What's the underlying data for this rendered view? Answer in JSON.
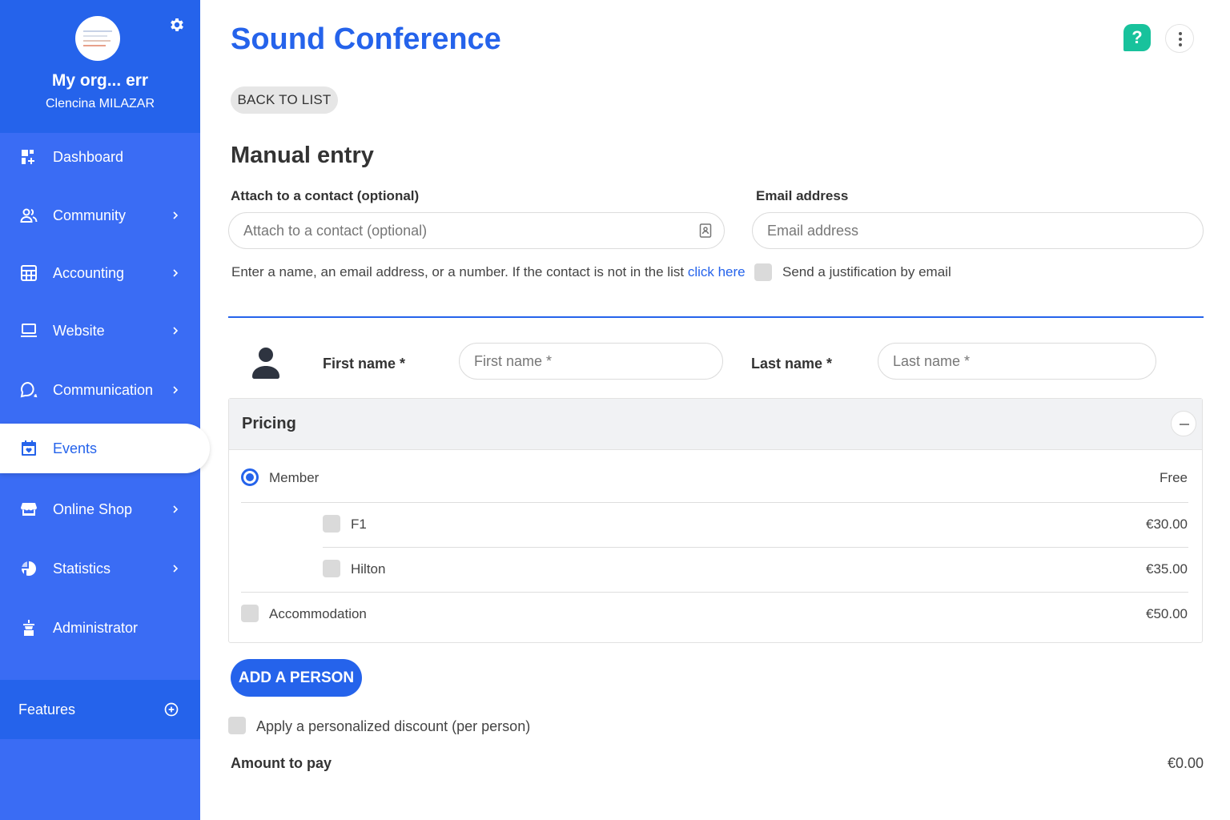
{
  "sidebar": {
    "org_name": "My org... err",
    "user_name": "Clencina MILAZAR",
    "items": [
      {
        "label": "Dashboard",
        "icon": "dashboard-icon"
      },
      {
        "label": "Community",
        "icon": "community-icon"
      },
      {
        "label": "Accounting",
        "icon": "calculator-icon"
      },
      {
        "label": "Website",
        "icon": "laptop-icon"
      },
      {
        "label": "Communication",
        "icon": "chat-icon"
      },
      {
        "label": "Events",
        "icon": "calendar-icon"
      },
      {
        "label": "Online Shop",
        "icon": "store-icon"
      },
      {
        "label": "Statistics",
        "icon": "pie-chart-icon"
      },
      {
        "label": "Administrator",
        "icon": "admin-icon"
      }
    ],
    "active": "Events",
    "features_label": "Features"
  },
  "header": {
    "title": "Sound Conference",
    "help_label": "?"
  },
  "back_label": "BACK TO LIST",
  "form": {
    "section_title": "Manual entry",
    "contact_label": "Attach to a contact (optional)",
    "contact_placeholder": "Attach to a contact (optional)",
    "contact_help": "Enter a name, an email address, or a number. If the contact is not in the list",
    "contact_help_link": "click here",
    "email_label": "Email address",
    "email_placeholder": "Email address",
    "justification_label": "Send a justification by email",
    "first_name_label": "First name *",
    "first_name_placeholder": "First name *",
    "last_name_label": "Last name *",
    "last_name_placeholder": "Last name *"
  },
  "pricing": {
    "title": "Pricing",
    "options": [
      {
        "label": "Member",
        "price": "Free",
        "selected": true
      },
      {
        "label": "F1",
        "price": "€30.00",
        "checked": false
      },
      {
        "label": "Hilton",
        "price": "€35.00",
        "checked": false
      },
      {
        "label": "Accommodation",
        "price": "€50.00",
        "checked": false
      }
    ]
  },
  "add_person_label": "ADD A PERSON",
  "discount_label": "Apply a personalized discount (per person)",
  "amount_label": "Amount to pay",
  "amount_value": "€0.00",
  "colors": {
    "accent": "#2563eb",
    "sidebar": "#3a6cf4",
    "help": "#18c29c"
  }
}
